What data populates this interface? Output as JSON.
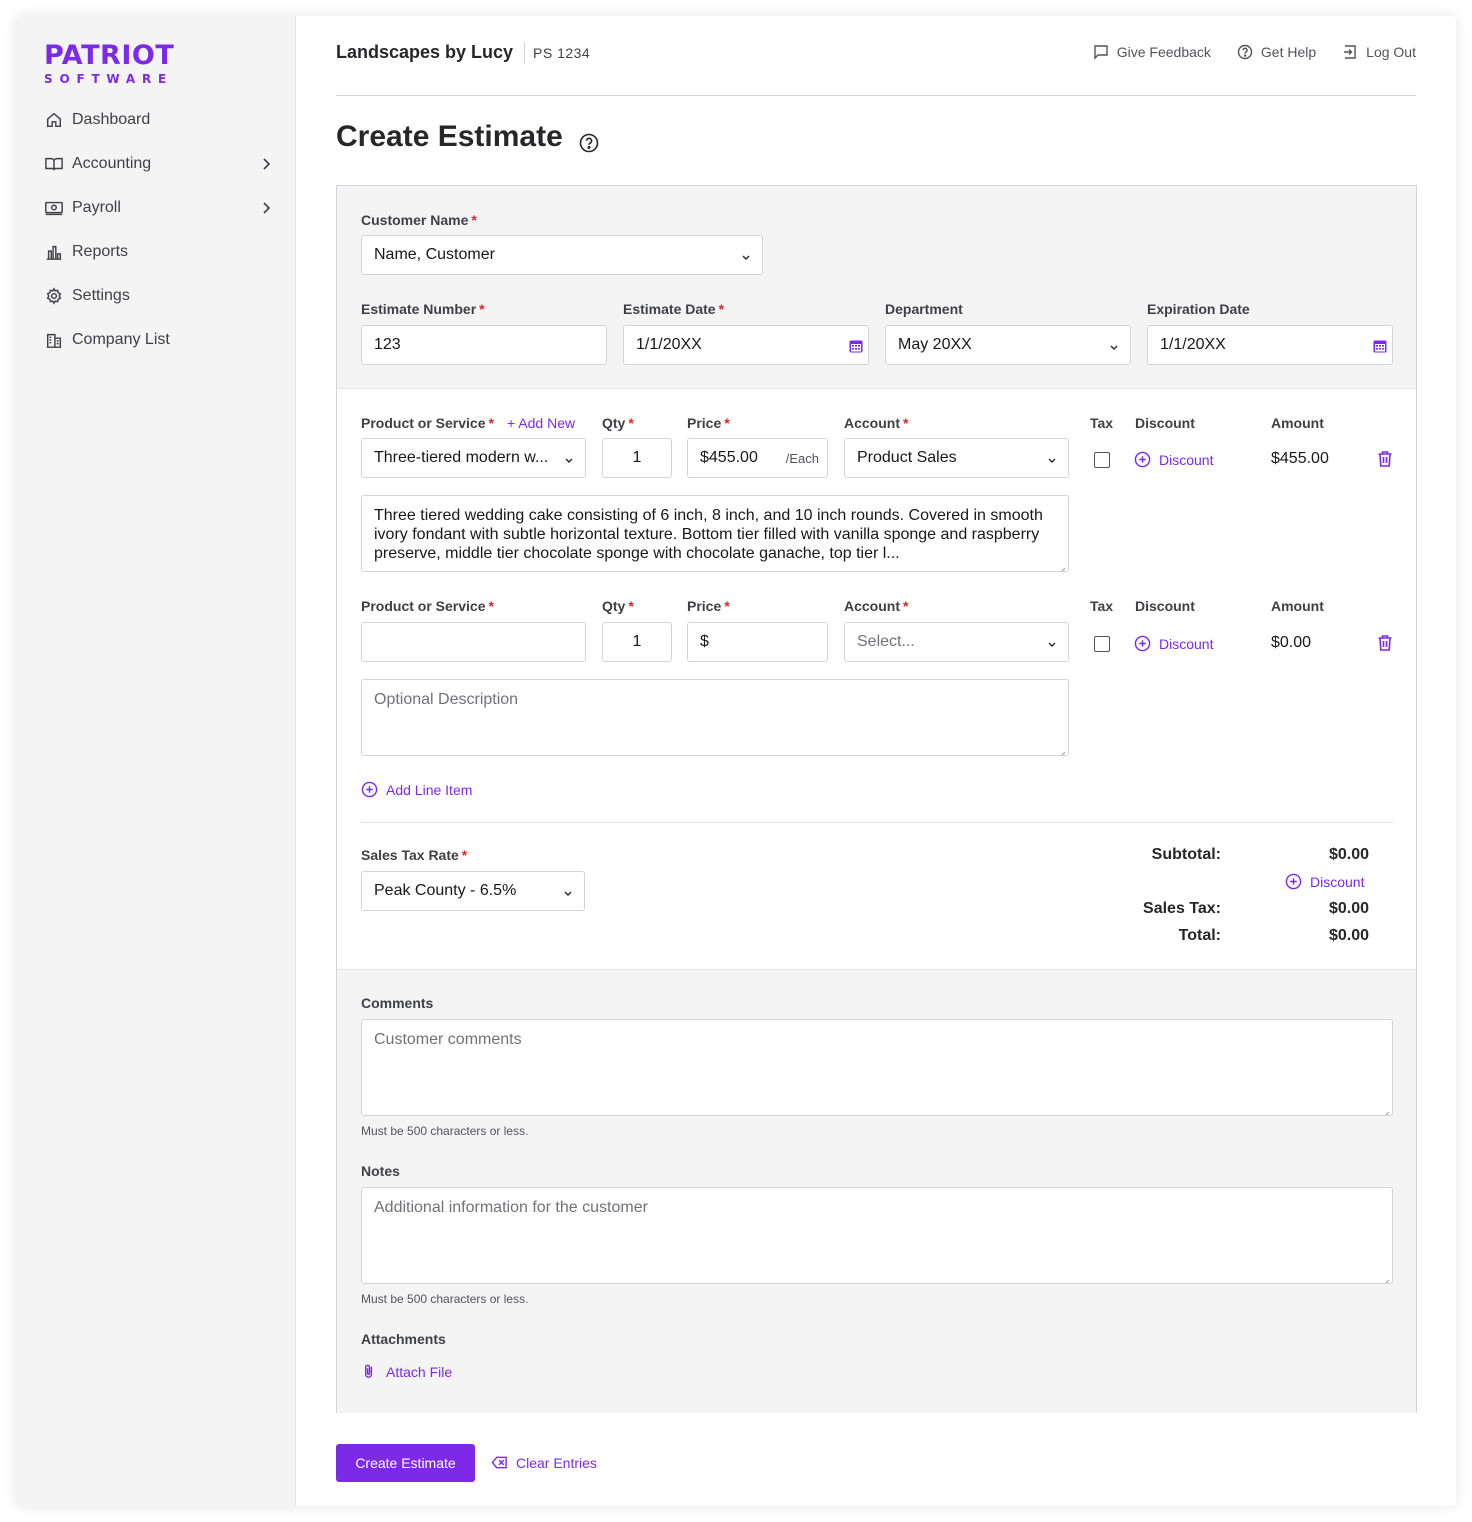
{
  "brand": {
    "line1": "PATRIOT",
    "line2": "SOFTWARE",
    "color": "#7c2ae8"
  },
  "sidebar": {
    "items": [
      {
        "label": "Dashboard",
        "icon": "home-icon"
      },
      {
        "label": "Accounting",
        "icon": "book-icon",
        "has_submenu": true
      },
      {
        "label": "Payroll",
        "icon": "money-icon",
        "has_submenu": true
      },
      {
        "label": "Reports",
        "icon": "bar-chart-icon"
      },
      {
        "label": "Settings",
        "icon": "gear-icon"
      },
      {
        "label": "Company List",
        "icon": "building-icon"
      }
    ]
  },
  "header": {
    "company": "Landscapes by Lucy",
    "company_id": "PS 1234",
    "links": {
      "feedback": "Give Feedback",
      "help": "Get Help",
      "logout": "Log Out"
    }
  },
  "page": {
    "title": "Create Estimate"
  },
  "form": {
    "customer": {
      "label": "Customer Name",
      "value": "Name, Customer"
    },
    "estimate_number": {
      "label": "Estimate Number",
      "value": "123"
    },
    "estimate_date": {
      "label": "Estimate Date",
      "value": "1/1/20XX"
    },
    "department": {
      "label": "Department",
      "value": "May 20XX"
    },
    "expiration_date": {
      "label": "Expiration Date",
      "value": "1/1/20XX"
    }
  },
  "columns": {
    "product": "Product or Service",
    "add_new": "+ Add New",
    "qty": "Qty",
    "price": "Price",
    "account": "Account",
    "tax": "Tax",
    "discount": "Discount",
    "amount": "Amount"
  },
  "lines": [
    {
      "product": "Three-tiered modern w...",
      "qty": "1",
      "price": "$455.00",
      "unit": "/Each",
      "account": "Product Sales",
      "discount_link": "Discount",
      "amount": "$455.00",
      "description": "Three tiered wedding cake consisting of 6 inch, 8 inch, and 10 inch rounds. Covered in smooth ivory fondant with subtle horizontal texture. Bottom tier filled with vanilla sponge and raspberry preserve, middle tier chocolate sponge with chocolate ganache, top tier l..."
    },
    {
      "product": "",
      "qty": "1",
      "price": "$",
      "account_placeholder": "Select...",
      "discount_link": "Discount",
      "amount": "$0.00",
      "description_placeholder": "Optional Description"
    }
  ],
  "add_line_item": "Add Line Item",
  "sales_tax": {
    "label": "Sales Tax Rate",
    "value": "Peak County - 6.5%"
  },
  "totals": {
    "subtotal_label": "Subtotal:",
    "subtotal": "$0.00",
    "discount_link": "Discount",
    "sales_tax_label": "Sales Tax:",
    "sales_tax": "$0.00",
    "total_label": "Total:",
    "total": "$0.00"
  },
  "comments": {
    "label": "Comments",
    "placeholder": "Customer comments",
    "hint": "Must be 500 characters or less."
  },
  "notes": {
    "label": "Notes",
    "placeholder": "Additional information for the customer",
    "hint": "Must be 500 characters or less."
  },
  "attachments": {
    "label": "Attachments",
    "link": "Attach File"
  },
  "actions": {
    "create": "Create Estimate",
    "clear": "Clear Entries"
  },
  "colors": {
    "accent": "#7c2ae8",
    "required": "#dc2626",
    "panel": "#f4f4f5"
  }
}
